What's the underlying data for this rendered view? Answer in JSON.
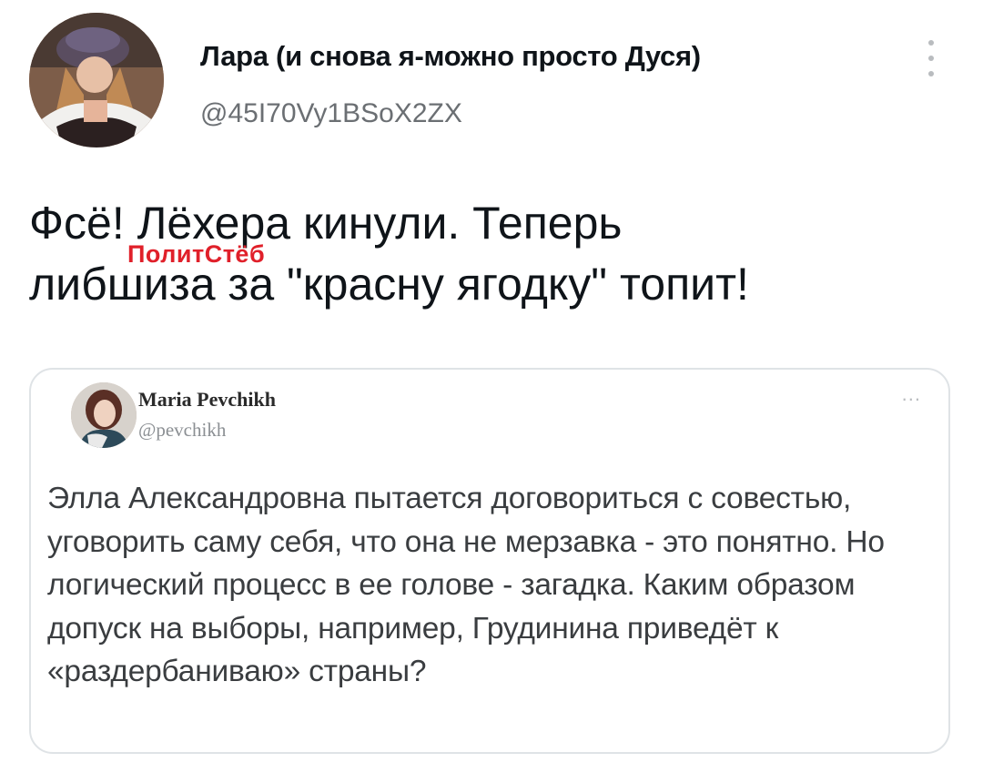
{
  "tweet": {
    "author_name": "Лара (и снова я-можно просто Дуся)",
    "author_handle": "@45I70Vy1BSoX2ZX",
    "text_line1": "Фсё! Лёхера кинули. Теперь",
    "text_line2": "либшиза за \"красну ягодку\" топит!",
    "watermark": "ПолитСтёб"
  },
  "quoted_tweet": {
    "author_name": "Maria Pevchikh",
    "author_handle": "@pevchikh",
    "more_label": "...",
    "text": "Элла Александровна пытается договориться с совестью, уговорить саму себя, что она не мерзавка - это понятно. Но логический процесс в ее голове - загадка. Каким образом допуск на выборы, например, Грудинина приведёт к «раздербаниваю» страны?"
  }
}
